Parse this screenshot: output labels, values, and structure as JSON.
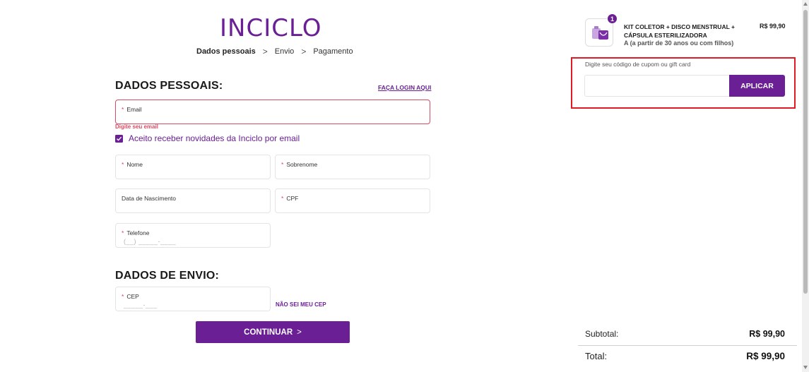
{
  "brand": {
    "logo_text": "INCICLO",
    "color": "#6b1f95"
  },
  "steps": [
    {
      "label": "Dados pessoais",
      "active": true
    },
    {
      "label": "Envio",
      "active": false
    },
    {
      "label": "Pagamento",
      "active": false
    }
  ],
  "step_separator": ">",
  "personal": {
    "title": "DADOS PESSOAIS:",
    "login_link": "FAÇA LOGIN AQUI",
    "email_label": "Email",
    "email_error": "Digite seu email",
    "newsletter_label": "Aceito receber novidades da Inciclo por email",
    "newsletter_checked": true,
    "name_label": "Nome",
    "surname_label": "Sobrenome",
    "birth_label": "Data de Nascimento",
    "cpf_label": "CPF",
    "phone_label": "Telefone",
    "phone_placeholder": "(__) _____-____",
    "required_mark": "*"
  },
  "shipping": {
    "title": "DADOS DE ENVIO:",
    "cep_label": "CEP",
    "cep_placeholder": "_____-___",
    "cep_link": "NÃO SEI MEU CEP"
  },
  "continue_button": {
    "label": "CONTINUAR",
    "chevron": ">"
  },
  "cart": {
    "quantity": "1",
    "product_name": "KIT COLETOR + DISCO MENSTRUAL + CÁPSULA ESTERILIZADORA",
    "product_subtitle": "A (a partir de 30 anos ou com filhos)",
    "product_price": "R$ 99,90"
  },
  "coupon": {
    "label": "Digite seu código de cupom ou gift card",
    "apply_label": "APLICAR",
    "highlight_color": "#e01b24"
  },
  "summary": {
    "subtotal_label": "Subtotal:",
    "subtotal_value": "R$ 99,90",
    "total_label": "Total:",
    "total_value": "R$ 99,90"
  }
}
